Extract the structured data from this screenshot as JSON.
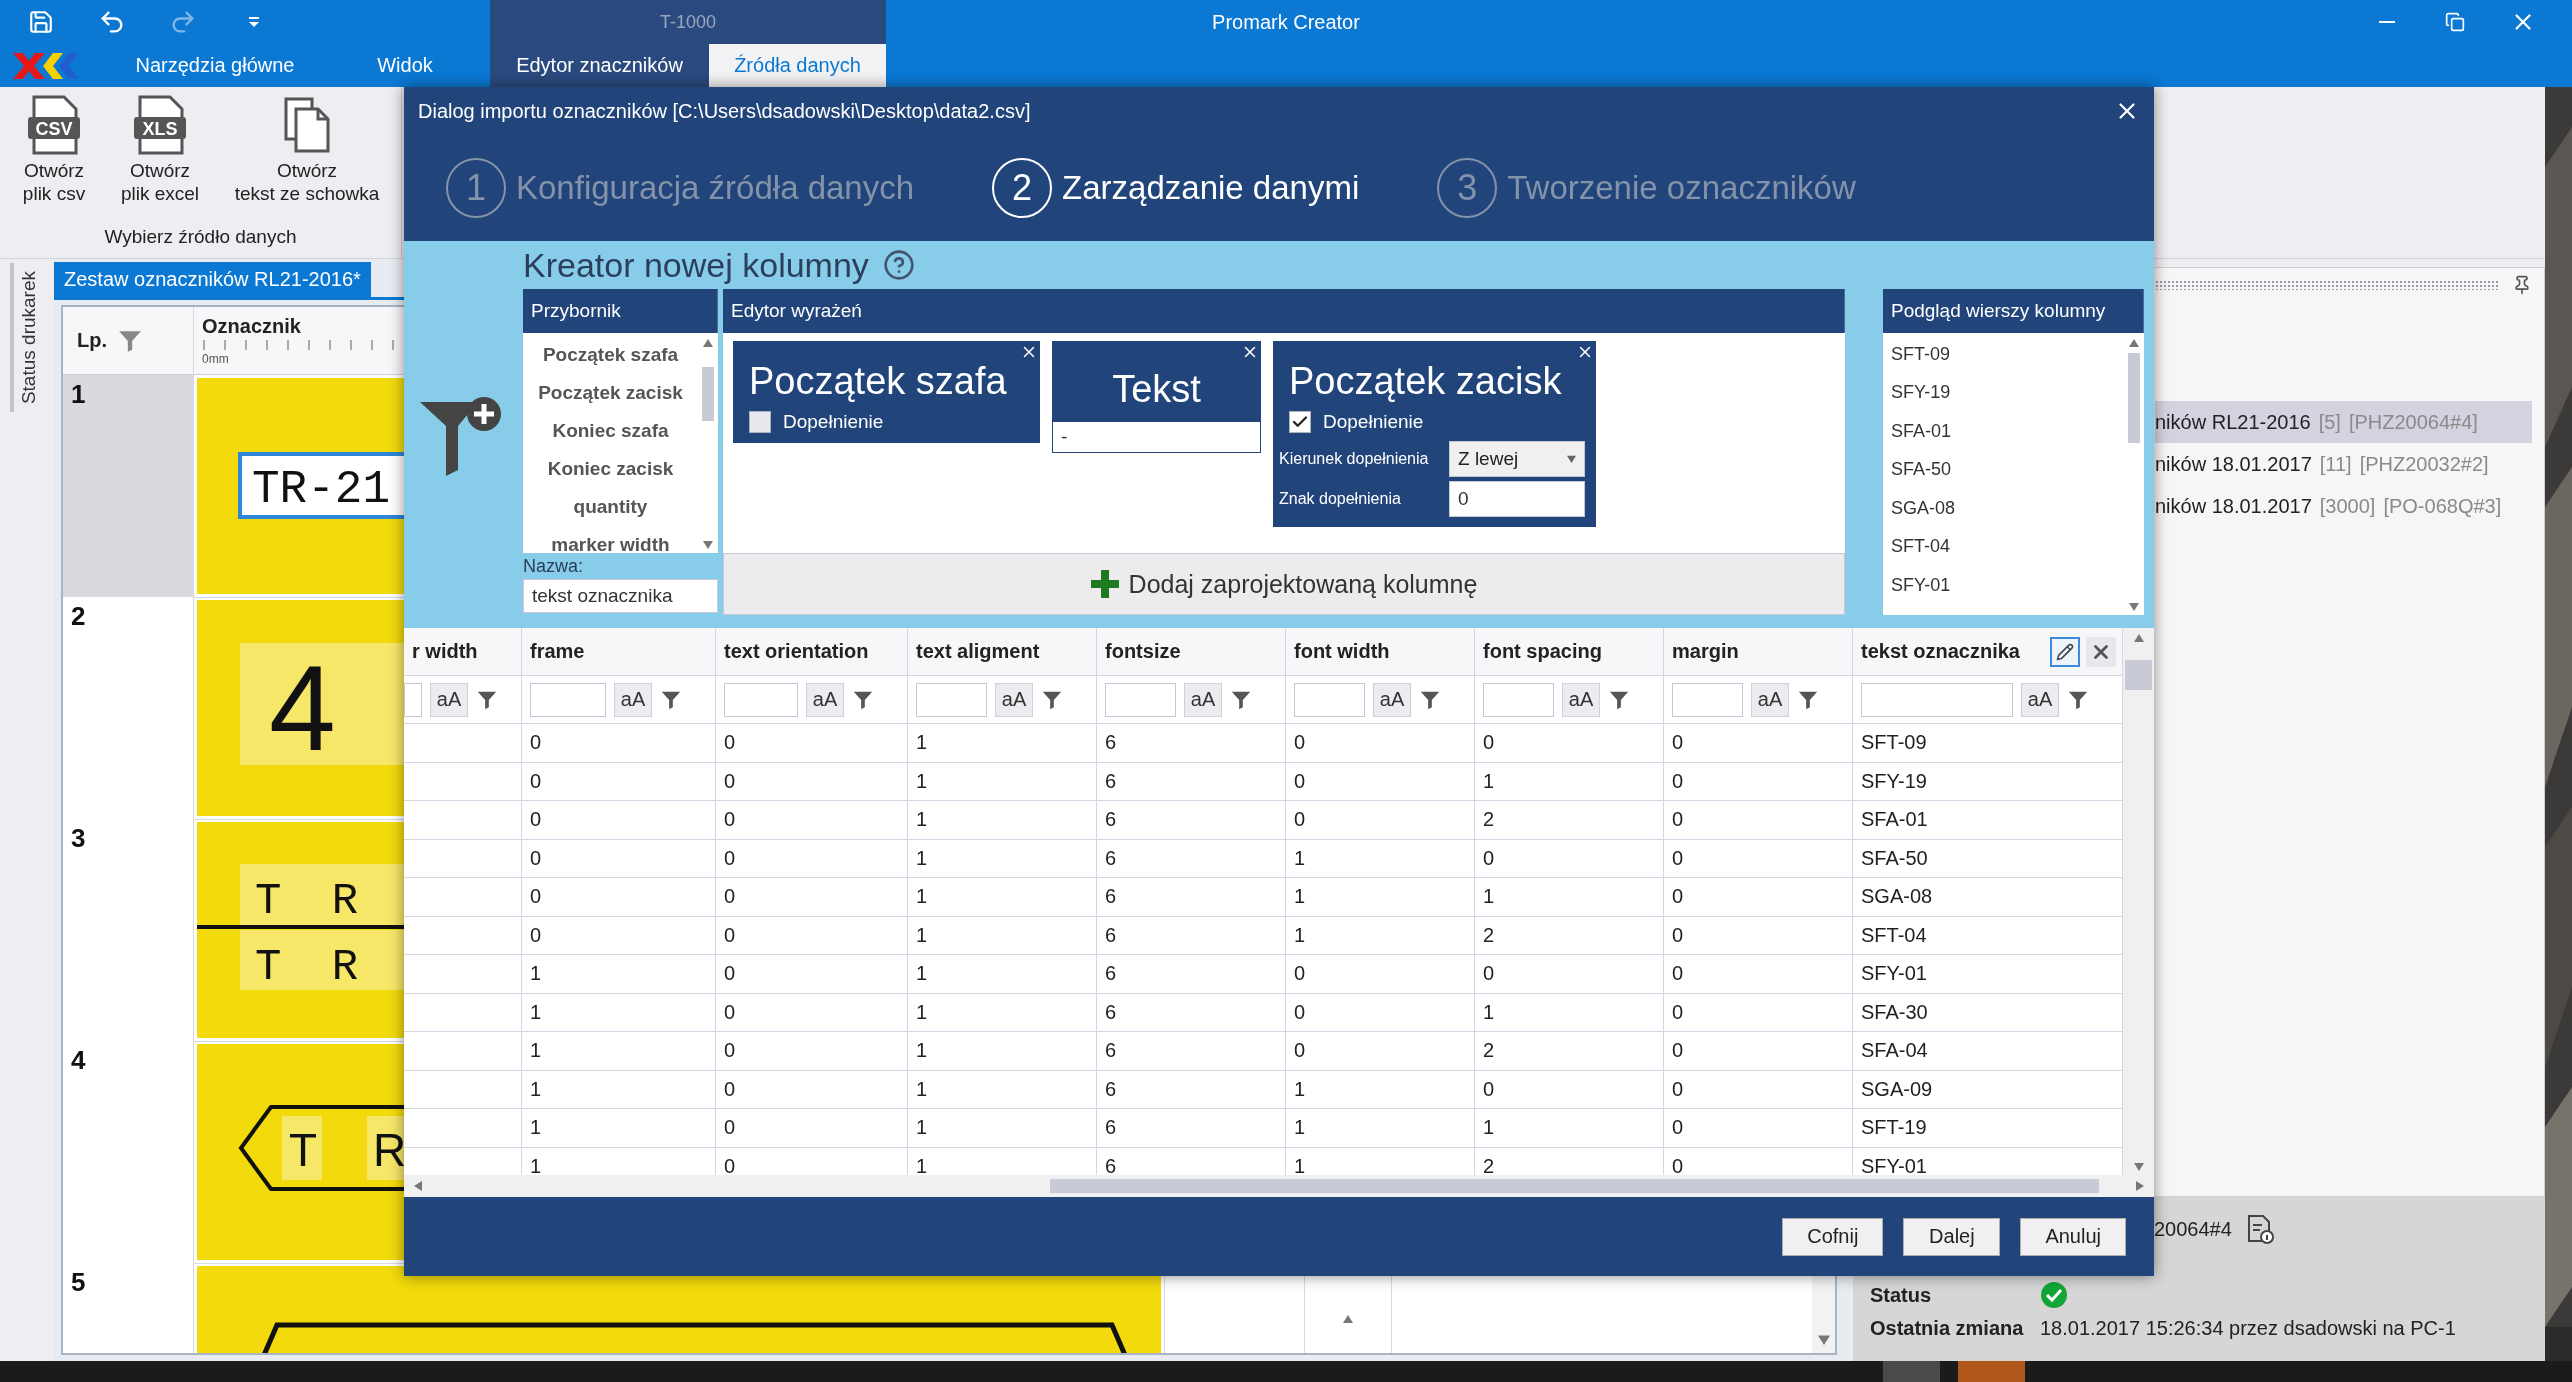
{
  "title_bar": {
    "title": "Promark Creator",
    "context_group": "T-1000"
  },
  "ribbon": {
    "tabs": [
      {
        "label": "Narzędzia główne",
        "selected": false
      },
      {
        "label": "Widok",
        "selected": false
      },
      {
        "label": "Edytor znaczników",
        "selected": false
      },
      {
        "label": "Źródła danych",
        "selected": true
      }
    ],
    "group": {
      "label": "Wybierz źródło danych",
      "buttons": [
        {
          "kind": "csv",
          "badge": "CSV",
          "lines": [
            "Otwórz",
            "plik csv"
          ]
        },
        {
          "kind": "xls",
          "badge": "XLS",
          "lines": [
            "Otwórz",
            "plik excel"
          ]
        },
        {
          "kind": "clipboard",
          "lines": [
            "Otwórz",
            "tekst ze schowka"
          ]
        }
      ]
    }
  },
  "side_tab": "Status drukarek",
  "document": {
    "tab": "Zestaw oznaczników RL21-2016*",
    "columns": [
      "Lp.",
      "Oznacznik"
    ],
    "ruler_label": "0mm",
    "rows": [
      {
        "number": "1",
        "selected": true,
        "kind": "framed",
        "texts": [
          "TR-21"
        ]
      },
      {
        "number": "2",
        "selected": false,
        "kind": "large",
        "texts": [
          "4"
        ]
      },
      {
        "number": "3",
        "selected": false,
        "kind": "split",
        "texts": [
          "T R",
          "T R"
        ]
      },
      {
        "number": "4",
        "selected": false,
        "kind": "arrow",
        "texts": [
          "T",
          "R"
        ]
      },
      {
        "number": "5",
        "selected": false,
        "kind": "hexagon"
      }
    ]
  },
  "right_panel": {
    "sets": [
      {
        "name": "ników RL21-2016",
        "count": "[5]",
        "code": "[PHZ20064#4]",
        "selected": true
      },
      {
        "name": "ników 18.01.2017",
        "count": "[11]",
        "code": "[PHZ20032#2]",
        "selected": false
      },
      {
        "name": "ników 18.01.2017",
        "count": "[3000]",
        "code": "[PO-068Q#3]",
        "selected": false
      }
    ],
    "printer_code": "20064#4",
    "status_label": "Status",
    "status_ok": true,
    "changed_label": "Ostatnia zmiana",
    "changed_value": "18.01.2017 15:26:34 przez dsadowski na PC-1"
  },
  "dialog": {
    "title": "Dialog importu oznaczników [C:\\Users\\dsadowski\\Desktop\\data2.csv]",
    "steps": [
      {
        "number": "1",
        "label": "Konfiguracja źródła danych",
        "selected": false
      },
      {
        "number": "2",
        "label": "Zarządzanie danymi",
        "selected": true
      },
      {
        "number": "3",
        "label": "Tworzenie oznaczników",
        "selected": false
      }
    ],
    "creator": {
      "title": "Kreator nowej kolumny",
      "toolbox": {
        "title": "Przybornik",
        "items": [
          "Początek szafa",
          "Początek zacisk",
          "Koniec szafa",
          "Koniec zacisk",
          "quantity",
          "marker width"
        ]
      },
      "name_label": "Nazwa:",
      "name_value": "tekst oznacznika",
      "editor": {
        "title": "Edytor wyrażeń",
        "blocks": [
          {
            "kind": "field",
            "title": "Początek szafa",
            "padding_label": "Dopełnienie",
            "checked": false
          },
          {
            "kind": "text",
            "title": "Tekst",
            "value": "-"
          },
          {
            "kind": "field",
            "title": "Początek zacisk",
            "padding_label": "Dopełnienie",
            "checked": true,
            "direction_label": "Kierunek dopełnienia",
            "direction_value": "Z lewej",
            "char_label": "Znak dopełnienia",
            "char_value": "0"
          }
        ]
      },
      "add_button": "Dodaj zaprojektowaną kolumnę",
      "preview": {
        "title": "Podgląd wierszy kolumny",
        "rows": [
          "SFT-09",
          "SFY-19",
          "SFA-01",
          "SFA-50",
          "SGA-08",
          "SFT-04",
          "SFY-01"
        ]
      }
    },
    "table": {
      "columns": [
        {
          "label": "r width",
          "case_button": "aA",
          "selected": false
        },
        {
          "label": "frame",
          "case_button": "aA",
          "selected": false
        },
        {
          "label": "text orientation",
          "case_button": "aA",
          "selected": false
        },
        {
          "label": "text aligment",
          "case_button": "aA",
          "selected": false
        },
        {
          "label": "fontsize",
          "case_button": "aA",
          "selected": false
        },
        {
          "label": "font width",
          "case_button": "aA",
          "selected": false
        },
        {
          "label": "font spacing",
          "case_button": "aA",
          "selected": false
        },
        {
          "label": "margin",
          "case_button": "aA",
          "selected": false
        },
        {
          "label": "tekst oznacznika",
          "case_button": "aA",
          "selected": true
        }
      ],
      "rows": [
        {
          "cells": [
            "",
            "0",
            "0",
            "1",
            "6",
            "0",
            "0",
            "0",
            "SFT-09"
          ]
        },
        {
          "cells": [
            "",
            "0",
            "0",
            "1",
            "6",
            "0",
            "1",
            "0",
            "SFY-19"
          ]
        },
        {
          "cells": [
            "",
            "0",
            "0",
            "1",
            "6",
            "0",
            "2",
            "0",
            "SFA-01"
          ]
        },
        {
          "cells": [
            "",
            "0",
            "0",
            "1",
            "6",
            "1",
            "0",
            "0",
            "SFA-50"
          ]
        },
        {
          "cells": [
            "",
            "0",
            "0",
            "1",
            "6",
            "1",
            "1",
            "0",
            "SGA-08"
          ]
        },
        {
          "cells": [
            "",
            "0",
            "0",
            "1",
            "6",
            "1",
            "2",
            "0",
            "SFT-04"
          ]
        },
        {
          "cells": [
            "",
            "1",
            "0",
            "1",
            "6",
            "0",
            "0",
            "0",
            "SFY-01"
          ]
        },
        {
          "cells": [
            "",
            "1",
            "0",
            "1",
            "6",
            "0",
            "1",
            "0",
            "SFA-30"
          ]
        },
        {
          "cells": [
            "",
            "1",
            "0",
            "1",
            "6",
            "0",
            "2",
            "0",
            "SFA-04"
          ]
        },
        {
          "cells": [
            "",
            "1",
            "0",
            "1",
            "6",
            "1",
            "0",
            "0",
            "SGA-09"
          ]
        },
        {
          "cells": [
            "",
            "1",
            "0",
            "1",
            "6",
            "1",
            "1",
            "0",
            "SFT-19"
          ]
        },
        {
          "cells": [
            "",
            "1",
            "0",
            "1",
            "6",
            "1",
            "2",
            "0",
            "SFY-01"
          ]
        }
      ]
    },
    "buttons": [
      "Cofnij",
      "Dalej",
      "Anuluj"
    ]
  }
}
